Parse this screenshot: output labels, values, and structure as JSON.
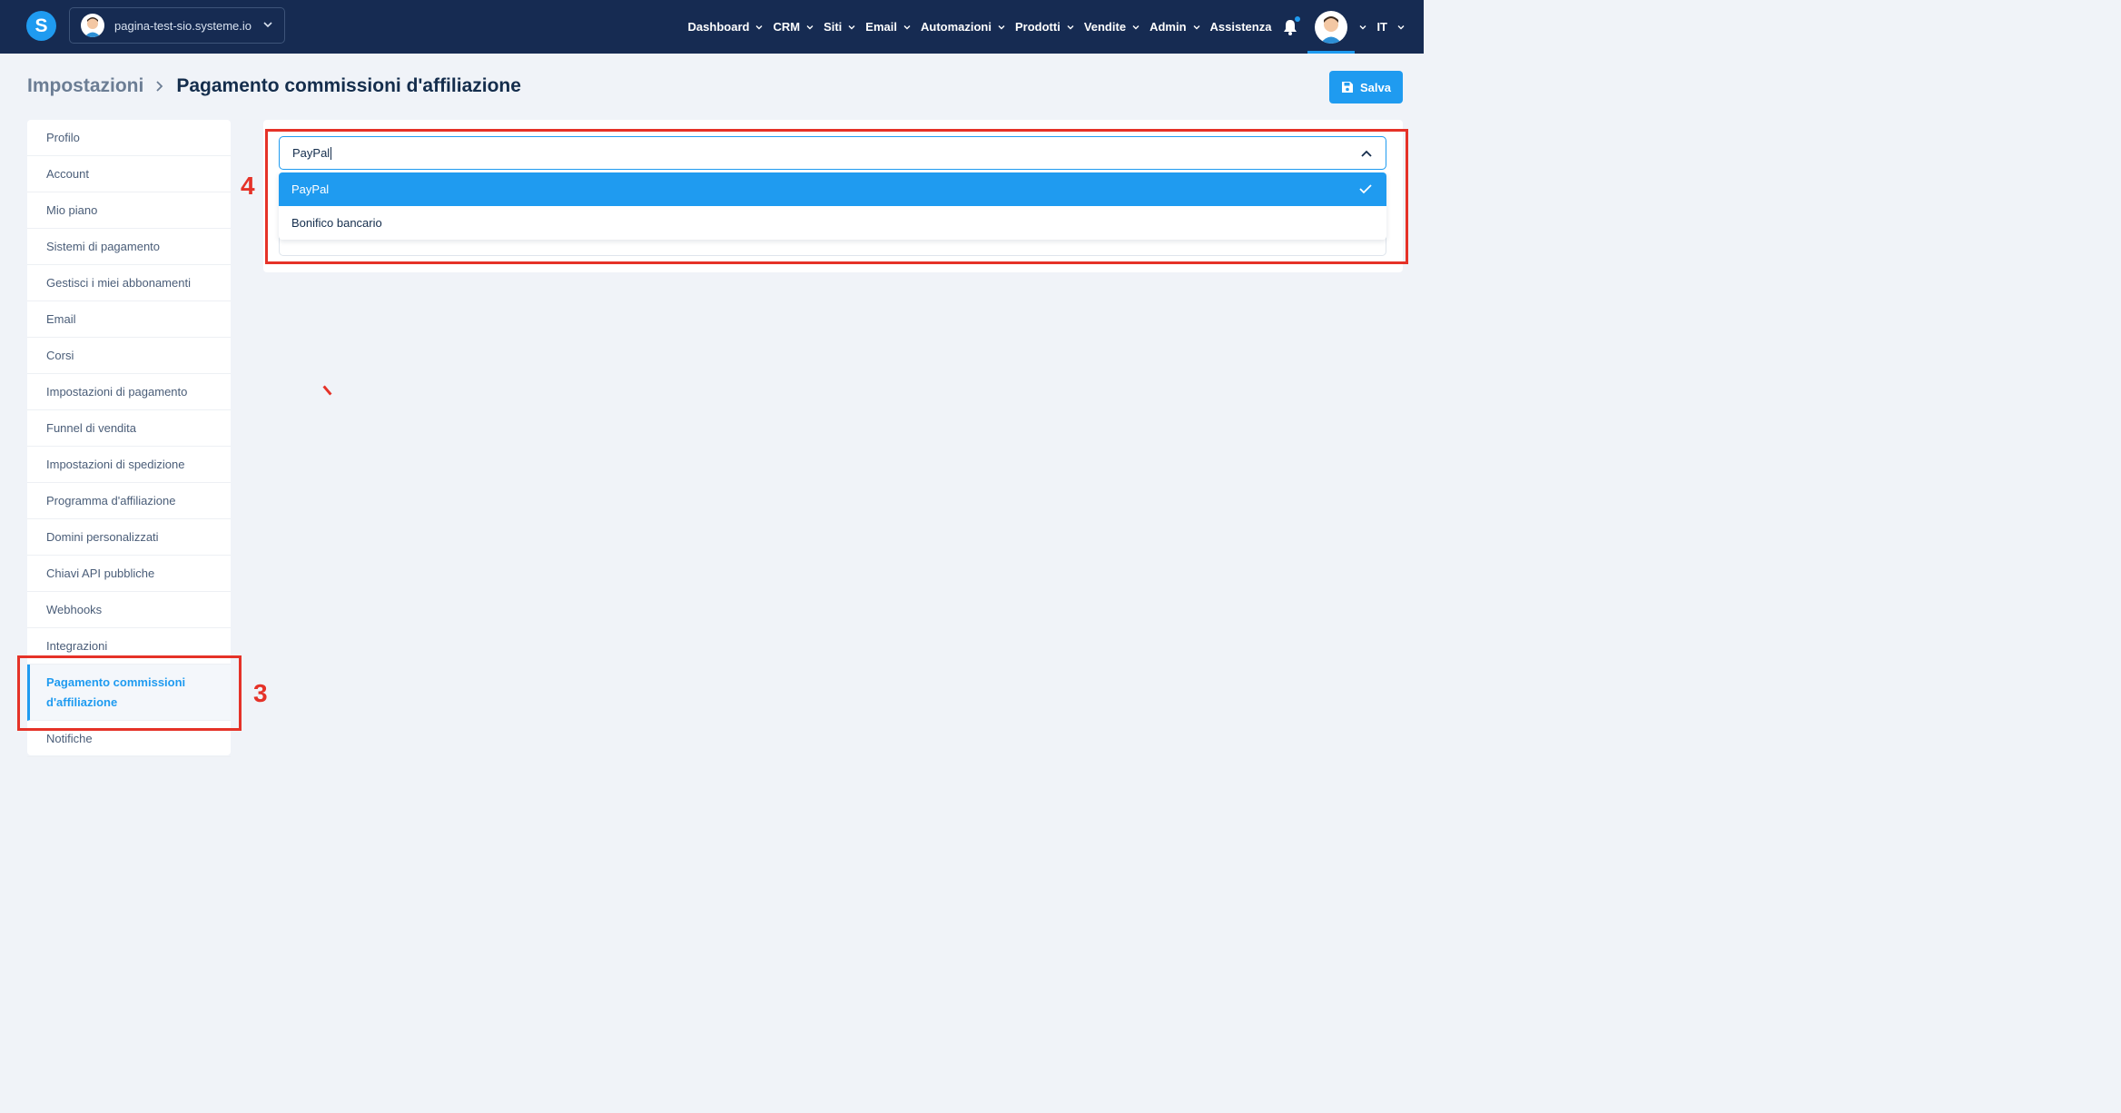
{
  "topbar": {
    "logo_letter": "S",
    "workspace_name": "pagina-test-sio.systeme.io",
    "nav": [
      {
        "label": "Dashboard"
      },
      {
        "label": "CRM"
      },
      {
        "label": "Siti"
      },
      {
        "label": "Email"
      },
      {
        "label": "Automazioni"
      },
      {
        "label": "Prodotti"
      },
      {
        "label": "Vendite"
      },
      {
        "label": "Admin"
      }
    ],
    "help_label": "Assistenza",
    "language": "IT"
  },
  "header": {
    "parent": "Impostazioni",
    "current": "Pagamento commissioni d'affiliazione",
    "save_label": "Salva"
  },
  "sidebar": {
    "items": [
      {
        "label": "Profilo"
      },
      {
        "label": "Account"
      },
      {
        "label": "Mio piano"
      },
      {
        "label": "Sistemi di pagamento"
      },
      {
        "label": "Gestisci i miei abbonamenti"
      },
      {
        "label": "Email"
      },
      {
        "label": "Corsi"
      },
      {
        "label": "Impostazioni di pagamento"
      },
      {
        "label": "Funnel di vendita"
      },
      {
        "label": "Impostazioni di spedizione"
      },
      {
        "label": "Programma d'affiliazione"
      },
      {
        "label": "Domini personalizzati"
      },
      {
        "label": "Chiavi API pubbliche"
      },
      {
        "label": "Webhooks"
      },
      {
        "label": "Integrazioni"
      }
    ],
    "active_line1": "Pagamento commissioni",
    "active_line2": "d'affiliazione",
    "after_active": "Notifiche"
  },
  "payment_select": {
    "value": "PayPal",
    "options": [
      {
        "label": "PayPal",
        "selected": true
      },
      {
        "label": "Bonifico bancario",
        "selected": false
      }
    ]
  },
  "annotations": {
    "step_sidebar": "3",
    "step_dropdown": "4",
    "color": "#e53228"
  },
  "colors": {
    "navy": "#162b52",
    "accent": "#1f9bf0"
  }
}
